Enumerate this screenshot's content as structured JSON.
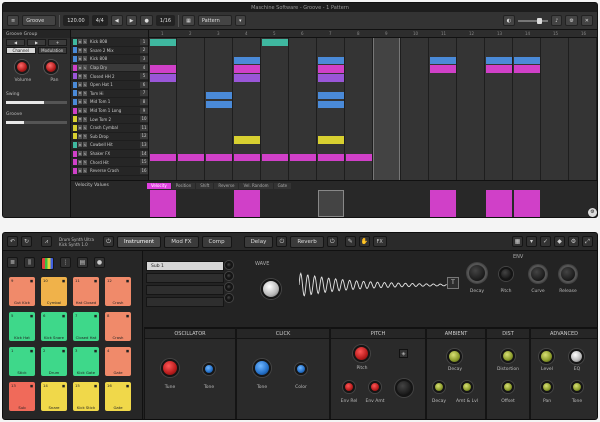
{
  "daw": {
    "title": "Maschine Software - Groove - 1 Pattern",
    "toolbar": {
      "project_label": "Groove",
      "tempo": "120.00",
      "signature": "4/4",
      "zoom": "1/16",
      "pattern_label": "Pattern",
      "grid_label": "Grid"
    },
    "left_panel": {
      "header": "Groove Group",
      "channel_label": "Channel",
      "mod_label": "Modulation",
      "knob1_label": "Volume",
      "knob2_label": "Pan",
      "row_a": "Swing",
      "row_b": "Groove",
      "swing_value": 0.62,
      "groove_value": 0.3
    },
    "tracks": [
      {
        "name": "Kick 808",
        "color": "#3fb8a0",
        "num": "1"
      },
      {
        "name": "Snare 2 Mix",
        "color": "#4a8ad8",
        "num": "2"
      },
      {
        "name": "Kick 808",
        "color": "#4a8ad8",
        "num": "3"
      },
      {
        "name": "Clap Dry",
        "color": "#d040c8",
        "num": "4"
      },
      {
        "name": "Closed HH 2",
        "color": "#9a56d8",
        "num": "5"
      },
      {
        "name": "Open Hat 1",
        "color": "#4a8ad8",
        "num": "6"
      },
      {
        "name": "Tom Hi",
        "color": "#4a8ad8",
        "num": "7"
      },
      {
        "name": "Mid Tom 1",
        "color": "#4a8ad8",
        "num": "8"
      },
      {
        "name": "Mid Tom 1 Long",
        "color": "#d040c8",
        "num": "9"
      },
      {
        "name": "Low Tom 2",
        "color": "#d8d030",
        "num": "10"
      },
      {
        "name": "Crash Cymbal",
        "color": "#d8d030",
        "num": "11"
      },
      {
        "name": "Sub Drop",
        "color": "#d8d030",
        "num": "12"
      },
      {
        "name": "Cowbell Hit",
        "color": "#3fb8a0",
        "num": "13"
      },
      {
        "name": "Shaker FX",
        "color": "#d040c8",
        "num": "14"
      },
      {
        "name": "Chord Hit",
        "color": "#d040c8",
        "num": "15"
      },
      {
        "name": "Reverse Crash",
        "color": "#d040c8",
        "num": "16"
      }
    ],
    "ruler": [
      "1",
      "2",
      "3",
      "4",
      "5",
      "6",
      "7",
      "8",
      "9",
      "10",
      "11",
      "12",
      "13",
      "14",
      "15",
      "16"
    ],
    "bottom_tabs": [
      "Velocity",
      "Position",
      "Shift",
      "Reverse",
      "Vel. Random",
      "Gate"
    ],
    "active_tab": "Velocity",
    "lane_label": "Velocity Values"
  },
  "instrument": {
    "title_line1": "Drum Synth Ultra",
    "title_line2": "Kick Synth 1.0",
    "tabs": [
      "Instrument",
      "Mod FX",
      "Comp"
    ],
    "active_tab": "Instrument",
    "mid_tabs": [
      "Delay",
      "Reverb"
    ],
    "fx_label": "FX",
    "pads": [
      {
        "n": "9",
        "t": "Gut Kick",
        "c": "#f08a6a"
      },
      {
        "n": "10",
        "t": "Cymbal",
        "c": "#f0b24a"
      },
      {
        "n": "11",
        "t": "Hat Closed",
        "c": "#f08a6a"
      },
      {
        "n": "12",
        "t": "Crash",
        "c": "#f08a6a"
      },
      {
        "n": "5",
        "t": "Kick Hat",
        "c": "#3ed88a"
      },
      {
        "n": "6",
        "t": "Kick Snare",
        "c": "#3ed88a"
      },
      {
        "n": "7",
        "t": "Closed Hat",
        "c": "#3ed88a"
      },
      {
        "n": "8",
        "t": "Crash",
        "c": "#f08a6a"
      },
      {
        "n": "1",
        "t": "Stick",
        "c": "#3ed88a"
      },
      {
        "n": "2",
        "t": "Drum",
        "c": "#3ed88a"
      },
      {
        "n": "3",
        "t": "Kick Gate",
        "c": "#3ed88a"
      },
      {
        "n": "4",
        "t": "Gate",
        "c": "#f08a6a"
      },
      {
        "n": "13",
        "t": "Sub",
        "c": "#f06a5a"
      },
      {
        "n": "14",
        "t": "Snare",
        "c": "#f0d84a"
      },
      {
        "n": "15",
        "t": "Kick Stick",
        "c": "#f0d84a"
      },
      {
        "n": "16",
        "t": "Gate",
        "c": "#f0d84a"
      }
    ],
    "slots": [
      "Sub 1",
      "",
      "",
      ""
    ],
    "wave_label": "WAVE",
    "env_label": "ENV",
    "env_knobs": [
      "Decay",
      "Pitch",
      "Curve",
      "Release"
    ],
    "sections": [
      {
        "title": "OSCILLATOR",
        "knobs": [
          "Tune",
          "Tone"
        ]
      },
      {
        "title": "CLICK",
        "knobs": [
          "Tone",
          "Color"
        ]
      },
      {
        "title": "PITCH",
        "knobs": [
          "Pitch",
          "Env Rel",
          "Env Amt"
        ]
      },
      {
        "title": "AMBIENT",
        "knobs": [
          "Decay",
          "Decay",
          "Amt & Lvl"
        ]
      },
      {
        "title": "DIST",
        "knobs": [
          "Distortion",
          "Offset"
        ]
      },
      {
        "title": "ADVANCED",
        "knobs": [
          "Level",
          "EQ",
          "Pan",
          "Tone"
        ]
      }
    ]
  }
}
